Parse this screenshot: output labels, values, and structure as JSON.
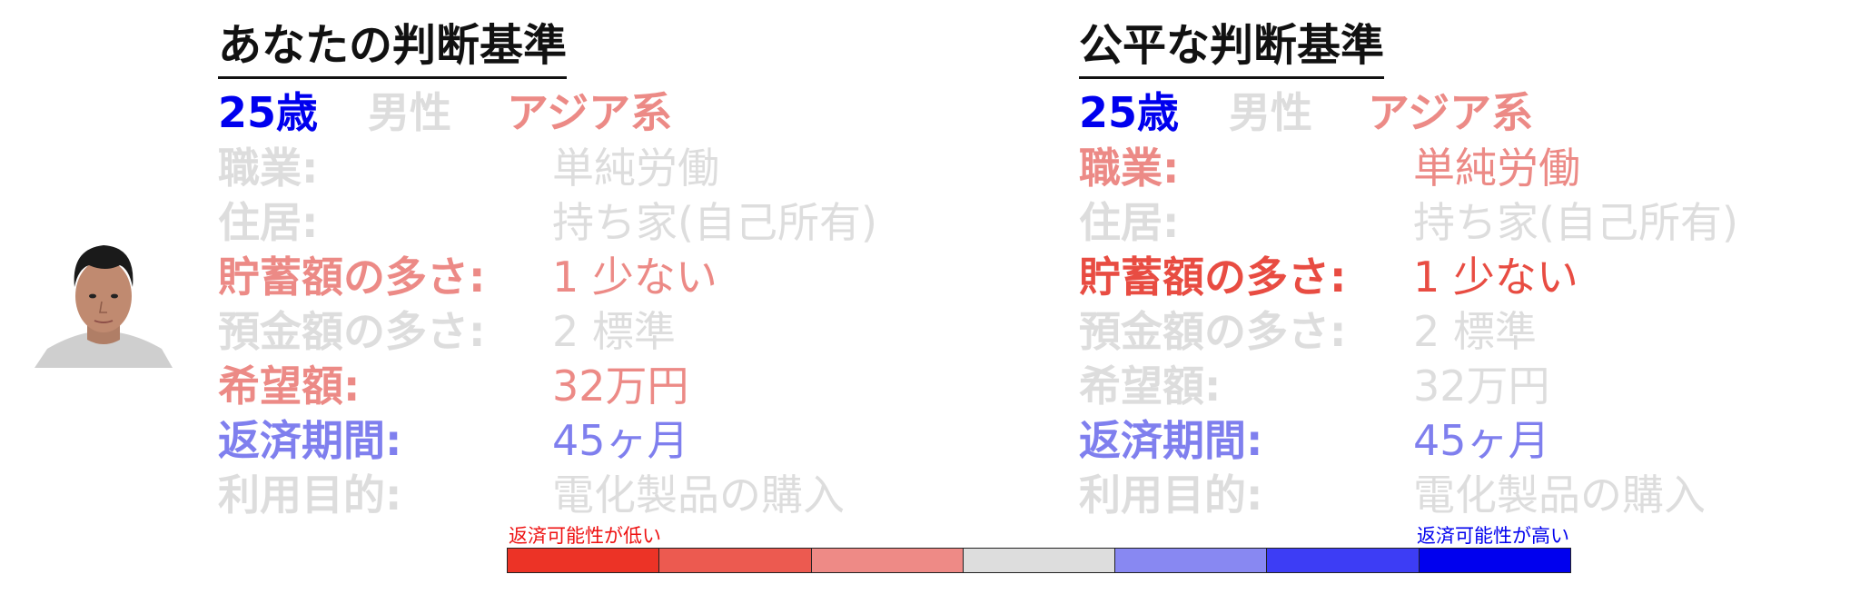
{
  "colors": {
    "gray": "#dddddd",
    "blue_strong": "#0000ee",
    "blue_light": "#7f7fee",
    "red_light": "#ec8a86",
    "red_mid": "#e84c42",
    "scale": [
      "#ec3326",
      "#ec5a50",
      "#ee8a86",
      "#dddddd",
      "#8888f2",
      "#3d3df5",
      "#0000ee"
    ]
  },
  "face": {
    "icon": "person-portrait"
  },
  "panels": [
    {
      "title": "あなたの判断基準",
      "demographics": [
        {
          "text": "25歳",
          "color": "#0000ee"
        },
        {
          "text": "男性",
          "color": "#dddddd"
        },
        {
          "text": "アジア系",
          "color": "#ec8a86"
        }
      ],
      "rows": [
        {
          "label": "職業:",
          "value": "単純労働",
          "color": "#dddddd"
        },
        {
          "label": "住居:",
          "value": "持ち家(自己所有)",
          "color": "#dddddd"
        },
        {
          "label": "貯蓄額の多さ:",
          "value": "1 少ない",
          "color": "#ec8a86"
        },
        {
          "label": "預金額の多さ:",
          "value": "2 標準",
          "color": "#dddddd"
        },
        {
          "label": "希望額:",
          "value": "32万円",
          "color": "#ec8a86"
        },
        {
          "label": "返済期間:",
          "value": "45ヶ月",
          "color": "#7f7fee"
        },
        {
          "label": "利用目的:",
          "value": "電化製品の購入",
          "color": "#dddddd"
        }
      ]
    },
    {
      "title": "公平な判断基準",
      "demographics": [
        {
          "text": "25歳",
          "color": "#0000ee"
        },
        {
          "text": "男性",
          "color": "#dddddd"
        },
        {
          "text": "アジア系",
          "color": "#ec8a86"
        }
      ],
      "rows": [
        {
          "label": "職業:",
          "value": "単純労働",
          "color": "#ec8a86"
        },
        {
          "label": "住居:",
          "value": "持ち家(自己所有)",
          "color": "#dddddd"
        },
        {
          "label": "貯蓄額の多さ:",
          "value": "1 少ない",
          "color": "#e84c42"
        },
        {
          "label": "預金額の多さ:",
          "value": "2 標準",
          "color": "#dddddd"
        },
        {
          "label": "希望額:",
          "value": "32万円",
          "color": "#dddddd"
        },
        {
          "label": "返済期間:",
          "value": "45ヶ月",
          "color": "#7f7fee"
        },
        {
          "label": "利用目的:",
          "value": "電化製品の購入",
          "color": "#dddddd"
        }
      ]
    }
  ],
  "scale": {
    "low_label": "返済可能性が低い",
    "high_label": "返済可能性が高い",
    "low_color": "#ee1111",
    "high_color": "#0000ee"
  }
}
